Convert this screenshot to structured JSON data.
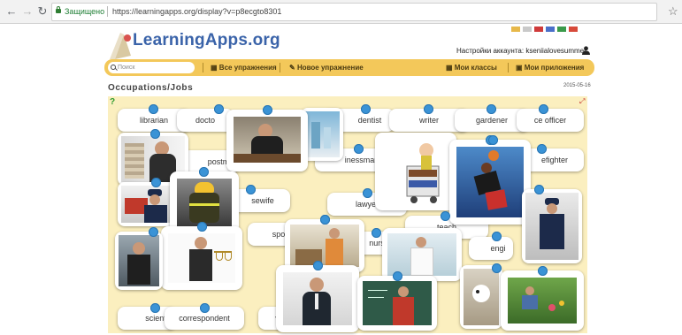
{
  "browser": {
    "secure_label": "Защищено",
    "url": "https://learningapps.org/display?v=p8ecgto8301"
  },
  "header": {
    "logo": "LearningApps.org",
    "account_label": "Настройки аккаунта: kseniialovesummer"
  },
  "navbar": {
    "search_placeholder": "Поиск",
    "all_exercises": "Все упражнения",
    "new_exercise": "Новое упражнение",
    "my_classes": "Мои классы",
    "my_apps": "Мои приложения"
  },
  "page": {
    "title": "Occupations/Jobs",
    "date": "2015-05-16"
  },
  "cards": {
    "librarian": "librarian",
    "doctor": "docto",
    "dentist": "dentist",
    "writer": "writer",
    "gardener": "gardener",
    "police_officer": "ce officer",
    "postman": "postm",
    "businessman": "inessman",
    "firefighter": "efighter",
    "housewife": "sewife",
    "lawyer": "lawyer",
    "teacher": "teach",
    "sportsman": "spo",
    "nurse": "nurs",
    "engineer": "engi",
    "scientist": "scienti",
    "correspondent": "correspondent",
    "vet": "ve"
  },
  "colors": {
    "navbar": "#f3c85a",
    "board": "#fbefbf",
    "pin": "#3a93d6",
    "logo": "#3a63a9"
  }
}
